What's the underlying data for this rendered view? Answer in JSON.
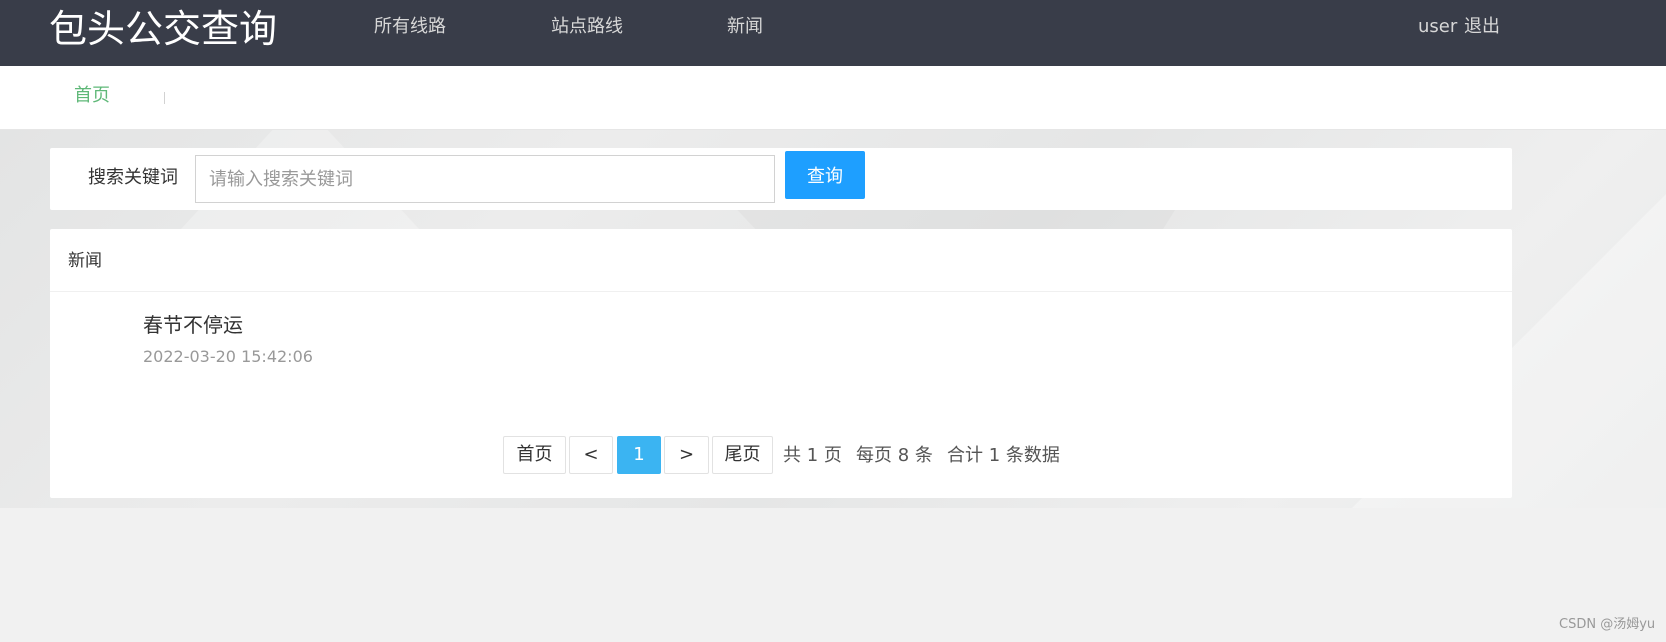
{
  "header": {
    "logo": "包头公交查询",
    "nav": [
      "所有线路",
      "站点路线",
      "新闻"
    ],
    "user": "user",
    "logout": "退出"
  },
  "subnav": {
    "home": "首页"
  },
  "search": {
    "label": "搜索关键词",
    "placeholder": "请输入搜索关键词",
    "value": "",
    "button": "查询"
  },
  "news": {
    "heading": "新闻",
    "items": [
      {
        "title": "春节不停运",
        "date": "2022-03-20 15:42:06"
      }
    ]
  },
  "pagination": {
    "first": "首页",
    "prev": "<",
    "current": "1",
    "next": ">",
    "last": "尾页",
    "total_pages": "共 1 页",
    "per_page": "每页 8 条",
    "total_rows": "合计 1 条数据"
  },
  "watermark": "CSDN @汤姆yu",
  "colors": {
    "topbar": "#393d49",
    "accent_green": "#5fb878",
    "button_blue": "#1e9fff",
    "page_current": "#3bb4f2"
  }
}
